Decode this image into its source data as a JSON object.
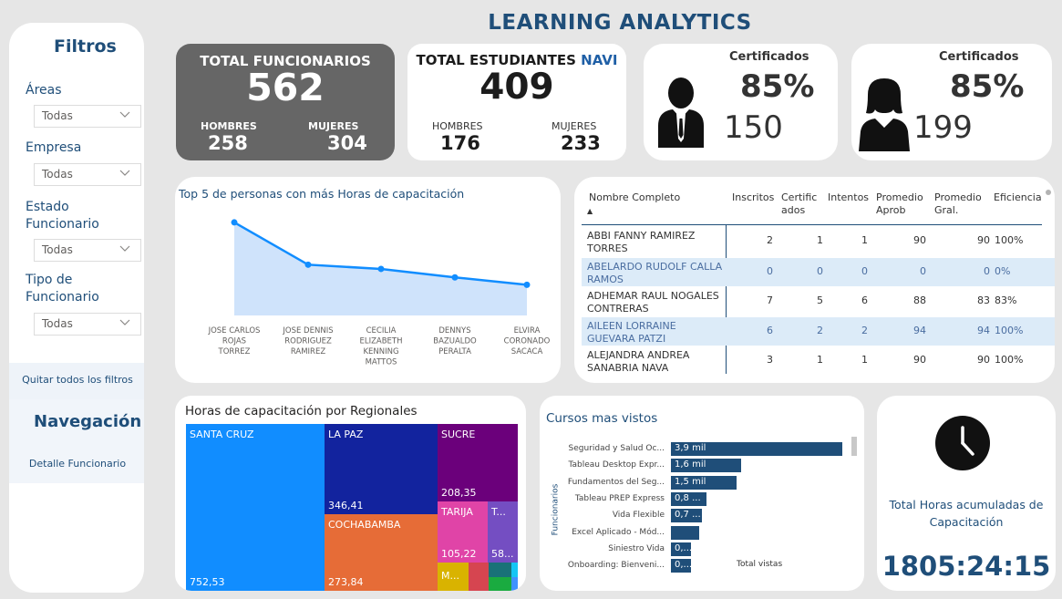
{
  "header": {
    "title": "LEARNING ANALYTICS"
  },
  "sidebar": {
    "filters_title": "Filtros",
    "filters": [
      {
        "label": "Áreas",
        "value": "Todas"
      },
      {
        "label": "Empresa",
        "value": "Todas"
      },
      {
        "label": "Estado Funcionario",
        "value": "Todas"
      },
      {
        "label": "Tipo de Funcionario",
        "value": "Todas"
      }
    ],
    "clear_filters": "Quitar todos los filtros",
    "nav_title": "Navegación",
    "nav_items": [
      "Detalle Funcionario"
    ]
  },
  "kpis": {
    "total_funcionarios": {
      "title": "TOTAL FUNCIONARIOS",
      "value": "562",
      "men_label": "HOMBRES",
      "men_value": "258",
      "women_label": "MUJERES",
      "women_value": "304"
    },
    "total_estudiantes": {
      "title": "TOTAL ESTUDIANTES",
      "title_accent": "NAVI",
      "value": "409",
      "men_label": "HOMBRES",
      "men_value": "176",
      "women_label": "MUJERES",
      "women_value": "233"
    },
    "cert_men": {
      "title": "Certificados",
      "percent": "85%",
      "count": "150"
    },
    "cert_women": {
      "title": "Certificados",
      "percent": "85%",
      "count": "199"
    }
  },
  "top5": {
    "title": "Top 5 de personas con más Horas de capacitación",
    "names": [
      [
        "JOSE CARLOS",
        "ROJAS",
        "TORREZ"
      ],
      [
        "JOSE DENNIS",
        "RODRIGUEZ",
        "RAMIREZ"
      ],
      [
        "CECILIA",
        "ELIZABETH",
        "KENNING",
        "MATTOS"
      ],
      [
        "DENNYS",
        "BAZUALDO",
        "PERALTA"
      ],
      [
        "ELVIRA",
        "CORONADO",
        "SACACA"
      ]
    ]
  },
  "table": {
    "headers": [
      "Nombre Completo",
      "Inscritos",
      "Certific ados",
      "Intentos",
      "Promedio Aprob",
      "Promedio Gral.",
      "Eficiencia"
    ],
    "rows": [
      {
        "name1": "ABBI FANNY RAMIREZ",
        "name2": "TORRES",
        "inscritos": "2",
        "certificados": "1",
        "intentos": "1",
        "prom_aprob": "90",
        "prom_gral": "90",
        "eficiencia": "100%"
      },
      {
        "name1": "ABELARDO RUDOLF CALLA",
        "name2": "RAMOS",
        "inscritos": "0",
        "certificados": "0",
        "intentos": "0",
        "prom_aprob": "0",
        "prom_gral": "0",
        "eficiencia": "0%"
      },
      {
        "name1": "ADHEMAR RAUL NOGALES",
        "name2": "CONTRERAS",
        "inscritos": "7",
        "certificados": "5",
        "intentos": "6",
        "prom_aprob": "88",
        "prom_gral": "83",
        "eficiencia": "83%"
      },
      {
        "name1": "AILEEN LORRAINE",
        "name2": "GUEVARA PATZI",
        "inscritos": "6",
        "certificados": "2",
        "intentos": "2",
        "prom_aprob": "94",
        "prom_gral": "94",
        "eficiencia": "100%"
      },
      {
        "name1": "ALEJANDRA ANDREA",
        "name2": "SANABRIA NAVA",
        "inscritos": "3",
        "certificados": "1",
        "intentos": "1",
        "prom_aprob": "90",
        "prom_gral": "90",
        "eficiencia": "100%"
      }
    ]
  },
  "treemap": {
    "title": "Horas de capacitación por Regionales",
    "cells": [
      {
        "name": "SANTA CRUZ",
        "value": "752,53",
        "color": "#118dff"
      },
      {
        "name": "LA PAZ",
        "value": "346,41",
        "color": "#12239e"
      },
      {
        "name": "SUCRE",
        "value": "208,35",
        "color": "#6b007b"
      },
      {
        "name": "COCHABAMBA",
        "value": "273,84",
        "color": "#e66c37"
      },
      {
        "name": "TARIJA",
        "value": "105,22",
        "color": "#e044a7"
      },
      {
        "name": "T...",
        "value": "58...",
        "color": "#744ec2"
      },
      {
        "name": "M...",
        "value": "",
        "color": "#d9b300"
      }
    ]
  },
  "courses": {
    "title": "Cursos mas vistos",
    "axis_y": "Funcionarios",
    "axis_x": "Total vistas",
    "items": [
      {
        "name": "Seguridad y Salud Oc...",
        "label": "3,9 mil",
        "value": 3900
      },
      {
        "name": "Tableau Desktop Expr...",
        "label": "1,6 mil",
        "value": 1600
      },
      {
        "name": "Fundamentos del Seg...",
        "label": "1,5 mil",
        "value": 1500
      },
      {
        "name": "Tableau PREP Express",
        "label": "0,8 ...",
        "value": 800
      },
      {
        "name": "Vida Flexible",
        "label": "0,7 ...",
        "value": 700
      },
      {
        "name": "Excel Aplicado - Mód...",
        "label": "",
        "value": 650
      },
      {
        "name": "Siniestro Vida",
        "label": "0,...",
        "value": 300
      },
      {
        "name": "Onboarding: Bienveni...",
        "label": "0,...",
        "value": 280
      }
    ]
  },
  "hours": {
    "title": "Total Horas acumuladas de Capacitación",
    "value": "1805:24:15"
  },
  "chart_data": [
    {
      "type": "line",
      "title": "Top 5 de personas con más Horas de capacitación",
      "categories": [
        "JOSE CARLOS ROJAS TORREZ",
        "JOSE DENNIS RODRIGUEZ RAMIREZ",
        "CECILIA ELIZABETH KENNING MATTOS",
        "DENNYS BAZUALDO PERALTA",
        "ELVIRA CORONADO SACACA"
      ],
      "values": [
        88,
        48,
        44,
        36,
        29
      ],
      "ylim": [
        0,
        100
      ]
    },
    {
      "type": "bar",
      "title": "Cursos mas vistos",
      "categories": [
        "Seguridad y Salud Oc...",
        "Tableau Desktop Expr...",
        "Fundamentos del Seg...",
        "Tableau PREP Express",
        "Vida Flexible",
        "Excel Aplicado - Mód...",
        "Siniestro Vida",
        "Onboarding: Bienveni..."
      ],
      "values": [
        3900,
        1600,
        1500,
        800,
        700,
        650,
        300,
        280
      ],
      "xlabel": "Total vistas",
      "ylabel": "Funcionarios"
    },
    {
      "type": "heatmap",
      "title": "Horas de capacitación por Regionales",
      "categories": [
        "SANTA CRUZ",
        "LA PAZ",
        "COCHABAMBA",
        "SUCRE",
        "TARIJA"
      ],
      "values": [
        752.53,
        346.41,
        273.84,
        208.35,
        105.22
      ]
    }
  ]
}
